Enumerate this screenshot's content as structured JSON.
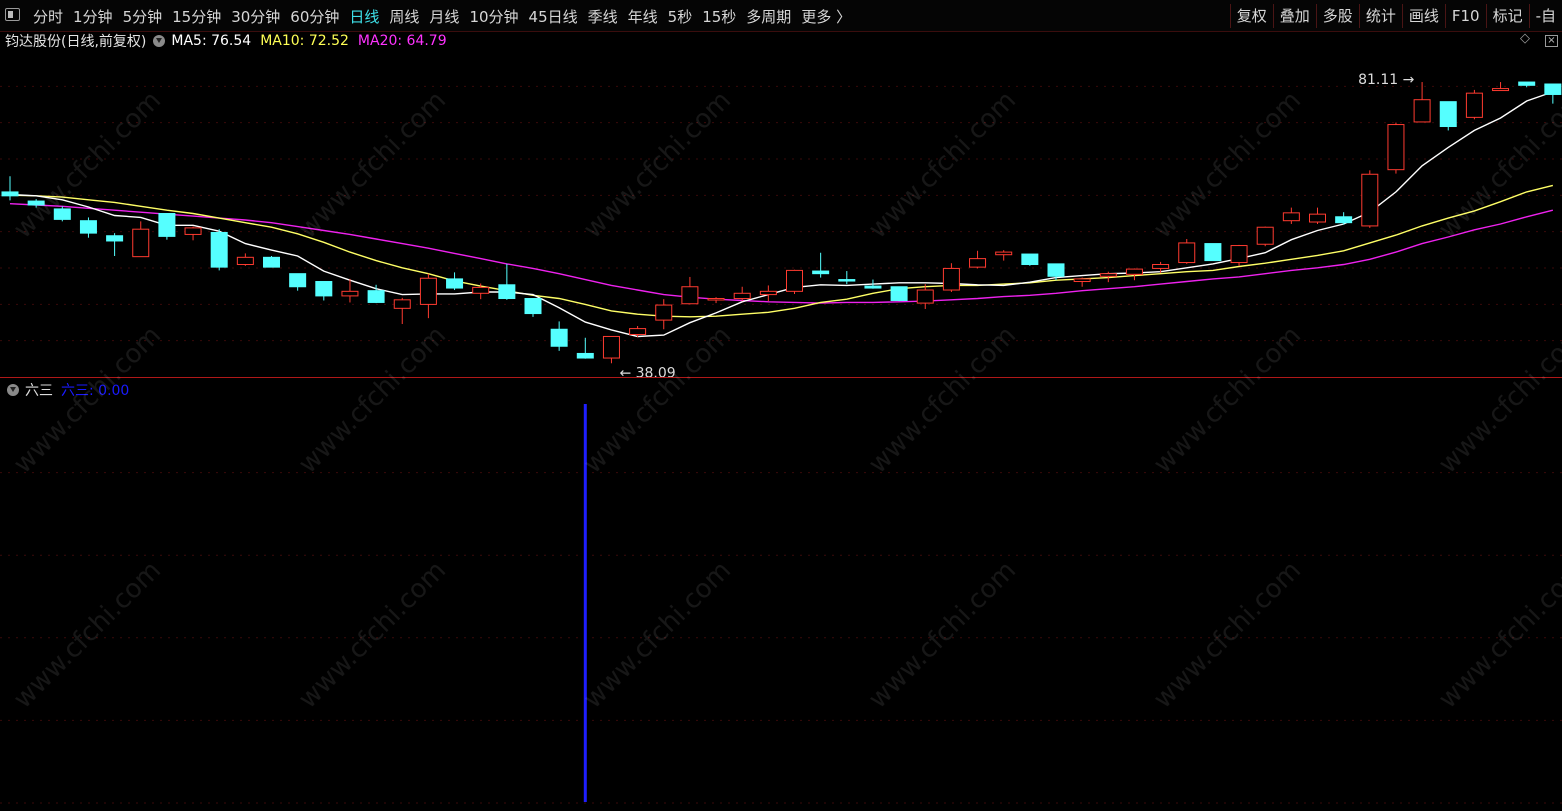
{
  "toolbar": {
    "periods": [
      "分时",
      "1分钟",
      "5分钟",
      "15分钟",
      "30分钟",
      "60分钟",
      "日线",
      "周线",
      "月线",
      "10分钟",
      "45日线",
      "季线",
      "年线",
      "5秒",
      "15秒",
      "多周期",
      "更多 〉"
    ],
    "active_period": "日线",
    "tools": [
      "复权",
      "叠加",
      "多股",
      "统计",
      "画线",
      "F10",
      "标记",
      "-自"
    ]
  },
  "price_header": {
    "title": "钧达股份(日线,前复权)",
    "ma5": "MA5: 76.54",
    "ma10": "MA10: 72.52",
    "ma20": "MA20: 64.79"
  },
  "annotations": {
    "low": "38.09",
    "high": "81.11"
  },
  "indicator": {
    "name": "六三",
    "value_label": "六三: 0.00"
  },
  "watermark": "www.cfchi.com",
  "colors": {
    "up": "#ff3b30",
    "down": "#55ffff",
    "ma5": "#ffffff",
    "ma10": "#ffff66",
    "ma20": "#ee22ee",
    "indicator": "#1f1fff",
    "background": "#000000"
  },
  "chart_data": {
    "type": "candlestick",
    "ylim": [
      36,
      86
    ],
    "candles": [
      {
        "o": 64.3,
        "h": 66.7,
        "l": 63.0,
        "c": 63.7
      },
      {
        "o": 62.9,
        "h": 63.2,
        "l": 61.9,
        "c": 62.3
      },
      {
        "o": 61.7,
        "h": 62.1,
        "l": 59.8,
        "c": 60.1
      },
      {
        "o": 59.9,
        "h": 60.4,
        "l": 57.3,
        "c": 58.0
      },
      {
        "o": 57.6,
        "h": 58.0,
        "l": 54.5,
        "c": 56.8
      },
      {
        "o": 54.4,
        "h": 59.8,
        "l": 54.4,
        "c": 58.6
      },
      {
        "o": 61.0,
        "h": 61.0,
        "l": 57.0,
        "c": 57.5
      },
      {
        "o": 57.8,
        "h": 59.0,
        "l": 56.9,
        "c": 58.8
      },
      {
        "o": 58.1,
        "h": 58.6,
        "l": 52.3,
        "c": 52.8
      },
      {
        "o": 53.2,
        "h": 54.9,
        "l": 53.0,
        "c": 54.3
      },
      {
        "o": 54.3,
        "h": 54.5,
        "l": 52.8,
        "c": 52.8
      },
      {
        "o": 51.8,
        "h": 51.8,
        "l": 49.2,
        "c": 49.8
      },
      {
        "o": 50.6,
        "h": 50.6,
        "l": 47.7,
        "c": 48.4
      },
      {
        "o": 48.4,
        "h": 51.0,
        "l": 47.4,
        "c": 49.1
      },
      {
        "o": 49.2,
        "h": 50.1,
        "l": 47.3,
        "c": 47.4
      },
      {
        "o": 46.5,
        "h": 48.1,
        "l": 44.1,
        "c": 47.8
      },
      {
        "o": 47.1,
        "h": 51.8,
        "l": 45.0,
        "c": 51.1
      },
      {
        "o": 51.0,
        "h": 52.0,
        "l": 49.3,
        "c": 49.6
      },
      {
        "o": 48.8,
        "h": 50.3,
        "l": 47.9,
        "c": 49.7
      },
      {
        "o": 50.1,
        "h": 53.3,
        "l": 47.8,
        "c": 48.0
      },
      {
        "o": 48.0,
        "h": 48.0,
        "l": 45.2,
        "c": 45.7
      },
      {
        "o": 43.3,
        "h": 44.5,
        "l": 40.0,
        "c": 40.7
      },
      {
        "o": 39.6,
        "h": 42.0,
        "l": 38.8,
        "c": 38.9
      },
      {
        "o": 38.9,
        "h": 42.2,
        "l": 38.1,
        "c": 42.2
      },
      {
        "o": 42.5,
        "h": 43.8,
        "l": 42.1,
        "c": 43.4
      },
      {
        "o": 44.7,
        "h": 47.9,
        "l": 43.3,
        "c": 47.0
      },
      {
        "o": 47.2,
        "h": 51.3,
        "l": 47.1,
        "c": 49.8
      },
      {
        "o": 47.8,
        "h": 48.2,
        "l": 47.3,
        "c": 48.0
      },
      {
        "o": 48.0,
        "h": 49.8,
        "l": 47.6,
        "c": 48.8
      },
      {
        "o": 48.6,
        "h": 50.0,
        "l": 47.6,
        "c": 49.1
      },
      {
        "o": 49.1,
        "h": 52.4,
        "l": 48.7,
        "c": 52.3
      },
      {
        "o": 52.2,
        "h": 55.0,
        "l": 51.2,
        "c": 51.8
      },
      {
        "o": 50.9,
        "h": 52.2,
        "l": 50.2,
        "c": 50.7
      },
      {
        "o": 49.9,
        "h": 50.9,
        "l": 49.5,
        "c": 49.6
      },
      {
        "o": 49.8,
        "h": 49.8,
        "l": 47.6,
        "c": 47.7
      },
      {
        "o": 47.3,
        "h": 50.2,
        "l": 46.4,
        "c": 49.3
      },
      {
        "o": 49.3,
        "h": 53.4,
        "l": 49.0,
        "c": 52.6
      },
      {
        "o": 52.8,
        "h": 55.3,
        "l": 52.6,
        "c": 54.1
      },
      {
        "o": 54.7,
        "h": 55.4,
        "l": 53.8,
        "c": 55.1
      },
      {
        "o": 54.8,
        "h": 54.8,
        "l": 53.0,
        "c": 53.2
      },
      {
        "o": 53.3,
        "h": 53.3,
        "l": 50.8,
        "c": 51.4
      },
      {
        "o": 50.6,
        "h": 51.2,
        "l": 49.8,
        "c": 51.0
      },
      {
        "o": 51.4,
        "h": 52.1,
        "l": 50.5,
        "c": 51.8
      },
      {
        "o": 51.7,
        "h": 52.6,
        "l": 50.8,
        "c": 52.5
      },
      {
        "o": 52.6,
        "h": 53.6,
        "l": 51.9,
        "c": 53.2
      },
      {
        "o": 53.5,
        "h": 57.1,
        "l": 53.3,
        "c": 56.5
      },
      {
        "o": 56.4,
        "h": 56.4,
        "l": 53.8,
        "c": 53.8
      },
      {
        "o": 53.5,
        "h": 56.2,
        "l": 53.0,
        "c": 56.1
      },
      {
        "o": 56.3,
        "h": 59.0,
        "l": 56.0,
        "c": 58.9
      },
      {
        "o": 59.9,
        "h": 61.9,
        "l": 59.4,
        "c": 61.1
      },
      {
        "o": 59.7,
        "h": 61.9,
        "l": 59.4,
        "c": 60.9
      },
      {
        "o": 60.5,
        "h": 61.2,
        "l": 59.3,
        "c": 59.6
      },
      {
        "o": 59.1,
        "h": 67.6,
        "l": 58.8,
        "c": 67.0
      },
      {
        "o": 67.7,
        "h": 74.9,
        "l": 67.1,
        "c": 74.6
      },
      {
        "o": 75.0,
        "h": 81.1,
        "l": 75.0,
        "c": 78.4
      },
      {
        "o": 78.1,
        "h": 78.1,
        "l": 73.7,
        "c": 74.3
      },
      {
        "o": 75.7,
        "h": 79.9,
        "l": 75.4,
        "c": 79.4
      },
      {
        "o": 79.8,
        "h": 81.1,
        "l": 79.8,
        "c": 80.1
      },
      {
        "o": 81.1,
        "h": 81.1,
        "l": 80.3,
        "c": 80.6
      },
      {
        "o": 80.8,
        "h": 80.8,
        "l": 77.8,
        "c": 79.2
      }
    ],
    "ma5": [
      63.9,
      63.7,
      63.1,
      62.0,
      60.7,
      60.4,
      59.2,
      59.2,
      58.3,
      56.4,
      55.4,
      54.5,
      52.2,
      50.8,
      49.5,
      48.6,
      48.7,
      48.7,
      49.0,
      49.0,
      48.6,
      46.6,
      44.4,
      43.2,
      42.2,
      42.4,
      44.3,
      45.8,
      47.5,
      48.6,
      49.7,
      50.1,
      50.0,
      50.2,
      50.4,
      50.4,
      50.3,
      50.1,
      50.0,
      50.5,
      51.2,
      51.5,
      51.8,
      51.9,
      52.1,
      52.7,
      53.3,
      54.1,
      55.0,
      57.0,
      58.4,
      59.4,
      61.2,
      64.3,
      68.3,
      71.1,
      73.7,
      75.6,
      78.2,
      79.6
    ],
    "ma10": [
      63.8,
      63.7,
      63.5,
      63.1,
      62.7,
      62.1,
      61.5,
      61.0,
      60.3,
      59.6,
      58.9,
      57.9,
      56.6,
      55.1,
      53.8,
      52.7,
      51.8,
      50.7,
      49.9,
      49.2,
      48.5,
      48.0,
      47.1,
      46.1,
      45.6,
      45.3,
      45.2,
      45.3,
      45.6,
      45.9,
      46.5,
      47.4,
      47.9,
      48.8,
      49.5,
      49.8,
      50.0,
      50.0,
      50.2,
      50.4,
      50.8,
      51.0,
      51.2,
      51.5,
      51.8,
      52.1,
      52.3,
      52.9,
      53.4,
      54.0,
      54.6,
      55.3,
      56.5,
      57.7,
      59.1,
      60.3,
      61.4,
      62.8,
      64.3,
      65.3
    ],
    "ma20": [
      62.5,
      62.3,
      62.1,
      61.8,
      61.5,
      61.2,
      60.9,
      60.6,
      60.3,
      60.0,
      59.6,
      59.0,
      58.4,
      57.8,
      57.1,
      56.4,
      55.7,
      54.9,
      54.1,
      53.3,
      52.6,
      51.8,
      50.9,
      50.0,
      49.3,
      48.6,
      48.2,
      47.9,
      47.7,
      47.5,
      47.4,
      47.3,
      47.4,
      47.4,
      47.5,
      47.6,
      47.8,
      48.0,
      48.3,
      48.5,
      48.8,
      49.2,
      49.5,
      49.8,
      50.2,
      50.6,
      51.0,
      51.3,
      51.8,
      52.3,
      52.7,
      53.2,
      54.0,
      55.1,
      56.4,
      57.4,
      58.5,
      59.4,
      60.5,
      61.5
    ],
    "indicator": {
      "name": "六三",
      "signal_index": 22,
      "value": 0.0
    }
  }
}
